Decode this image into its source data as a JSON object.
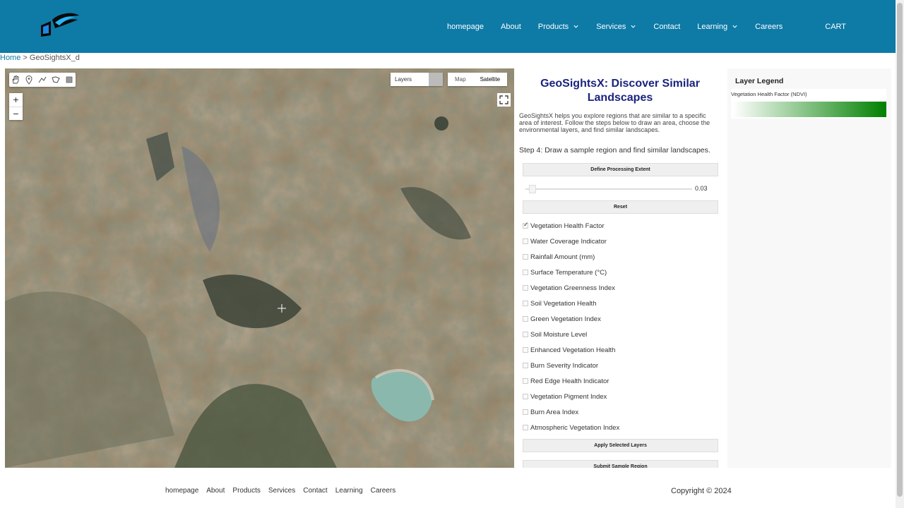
{
  "header": {
    "nav": [
      {
        "label": "homepage",
        "dropdown": false
      },
      {
        "label": "About",
        "dropdown": false
      },
      {
        "label": "Products",
        "dropdown": true
      },
      {
        "label": "Services",
        "dropdown": true
      },
      {
        "label": "Contact",
        "dropdown": false
      },
      {
        "label": "Learning",
        "dropdown": true
      },
      {
        "label": "Careers",
        "dropdown": false
      }
    ],
    "cart_label": "CART",
    "colors": {
      "bar": "#0e7aa6",
      "text": "#ffffff"
    }
  },
  "breadcrumb": {
    "home": "Home",
    "separator": " > ",
    "current": "GeoSightsX_d"
  },
  "map": {
    "layers_label": "Layers",
    "map_type_options": [
      "Map",
      "Satellite"
    ],
    "map_type_selected": "Satellite",
    "zoom_in": "+",
    "zoom_out": "−",
    "tools": [
      "hand-icon",
      "marker-icon",
      "polyline-icon",
      "polygon-icon",
      "rectangle-icon"
    ]
  },
  "panel": {
    "title": "GeoSightsX: Discover Similar Landscapes",
    "intro": "GeoSightsX helps you explore regions that are similar to a specific area of interest. Follow the steps below to draw an area, choose the environmental layers, and find similar landscapes.",
    "step": "Step 4: Draw a sample region and find similar landscapes.",
    "define_extent_label": "Define Processing Extent",
    "slider_value": "0.03",
    "reset_label": "Reset",
    "layers": [
      {
        "label": "Vegetation Health Factor",
        "checked": true
      },
      {
        "label": "Water Coverage Indicator",
        "checked": false
      },
      {
        "label": "Rainfall Amount (mm)",
        "checked": false
      },
      {
        "label": "Surface Temperature (°C)",
        "checked": false
      },
      {
        "label": "Vegetation Greenness Index",
        "checked": false
      },
      {
        "label": "Soil Vegetation Health",
        "checked": false
      },
      {
        "label": "Green Vegetation Index",
        "checked": false
      },
      {
        "label": "Soil Moisture Level",
        "checked": false
      },
      {
        "label": "Enhanced Vegetation Health",
        "checked": false
      },
      {
        "label": "Burn Severity Indicator",
        "checked": false
      },
      {
        "label": "Red Edge Health Indicator",
        "checked": false
      },
      {
        "label": "Vegetation Pigment Index",
        "checked": false
      },
      {
        "label": "Burn Area Index",
        "checked": false
      },
      {
        "label": "Atmospheric Vegetation Index",
        "checked": false
      }
    ],
    "apply_label": "Apply Selected Layers",
    "submit_label": "Submit Sample Region",
    "title_color": "#1a237e"
  },
  "legend": {
    "title": "Layer Legend",
    "item_label": "Vegetation Health Factor (NDVI)",
    "gradient": [
      "#ffffff",
      "#008000"
    ]
  },
  "footer": {
    "links": [
      "homepage",
      "About",
      "Products",
      "Services",
      "Contact",
      "Learning",
      "Careers"
    ],
    "copyright": "Copyright © 2024"
  }
}
